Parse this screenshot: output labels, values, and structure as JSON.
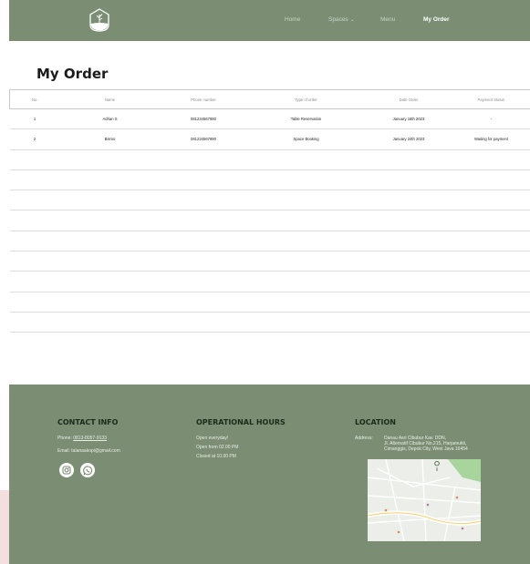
{
  "nav": {
    "links": [
      "Home",
      "Spaces",
      "Menu",
      "My Order"
    ],
    "active": "My Order"
  },
  "page": {
    "title": "My Order"
  },
  "table": {
    "headers": [
      "No.",
      "Name",
      "Phone number",
      "Type of order",
      "Date Order",
      "Payment Status"
    ],
    "rows": [
      [
        "1",
        "Adrian S",
        "081234567890",
        "Table Reservation",
        "January 18th 2023",
        "-"
      ],
      [
        "2",
        "Bismo",
        "081234567890",
        "Space Booking",
        "January 24th 2023",
        "Waiting for payment"
      ]
    ],
    "empty_row_count": 9
  },
  "footer": {
    "contact": {
      "heading": "CONTACT INFO",
      "phone_label": "Phone:",
      "phone": "0813-8057-9133",
      "email_label": "Email:",
      "email": "talanaakopi@gmail.com"
    },
    "hours": {
      "heading": "OPERATIONAL HOURS",
      "line1": "Open everyday!",
      "line2": "Open from 02.00 PM",
      "line3": "Closed at 10.00 PM"
    },
    "location": {
      "heading": "LOCATION",
      "address_label": "Address:",
      "address_line1": "Danau Asri Cibubur Kav. DDN,",
      "address_line2": "Jl. Alternatif Cibubur No.215, Harjamukti,",
      "address_line3": "Cimanggis, Depok City, West Java 16454"
    }
  },
  "icons": {
    "brand": "plant-logo-icon",
    "social": [
      "instagram-icon",
      "whatsapp-icon"
    ]
  },
  "colors": {
    "header_bg": "#7b8e74",
    "footer_bg": "#7b8e74",
    "nav_active": "#ffffff"
  }
}
